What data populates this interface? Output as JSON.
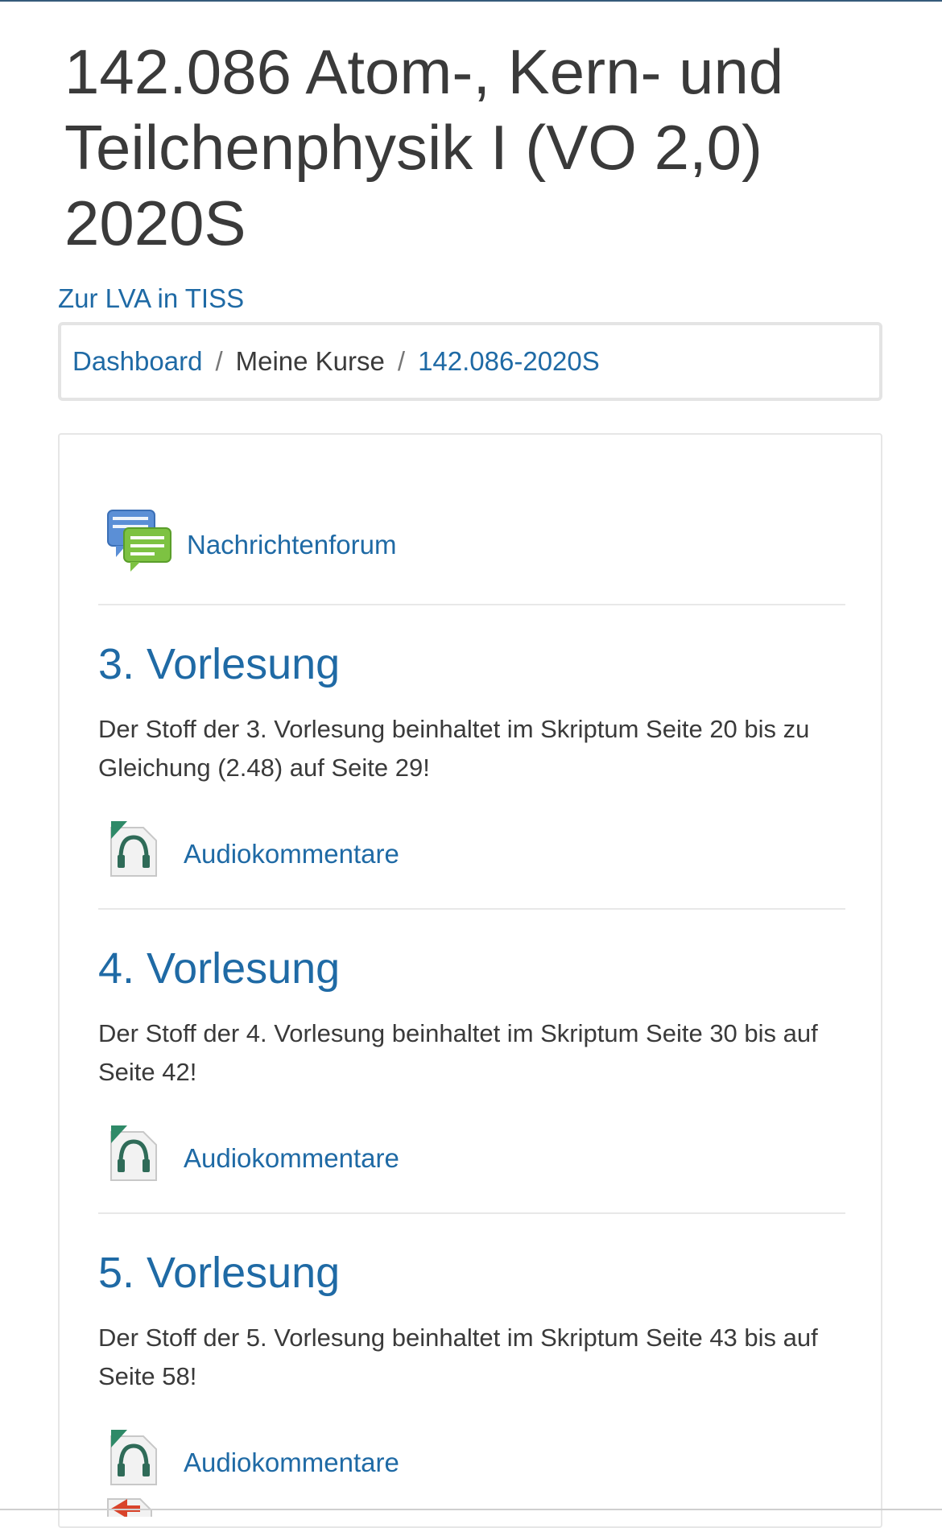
{
  "course": {
    "title": "142.086 Atom-, Kern- und Teilchenphysik I (VO 2,0) 2020S",
    "tiss_link": "Zur LVA in TISS"
  },
  "breadcrumb": {
    "items": [
      "Dashboard",
      "Meine Kurse",
      "142.086-2020S"
    ],
    "separator": "/"
  },
  "forum": {
    "label": "Nachrichtenforum",
    "icon": "forum-icon"
  },
  "sections": [
    {
      "title": "3. Vorlesung",
      "summary": "Der Stoff der 3. Vorlesung beinhaltet im Skriptum Seite 20 bis zu Gleichung (2.48) auf Seite 29!",
      "activity": "Audiokommentare"
    },
    {
      "title": "4. Vorlesung",
      "summary": "Der Stoff der 4. Vorlesung beinhaltet im Skriptum Seite 30 bis auf Seite 42!",
      "activity": "Audiokommentare"
    },
    {
      "title": "5. Vorlesung",
      "summary": "Der Stoff der 5. Vorlesung beinhaltet im Skriptum Seite 43 bis auf Seite 58!",
      "activity": "Audiokommentare"
    }
  ],
  "icons": {
    "audio": "headphones-file-icon"
  },
  "colors": {
    "link": "#1f6aa5",
    "text": "#3a3a3a",
    "border": "#e4e4e4"
  }
}
